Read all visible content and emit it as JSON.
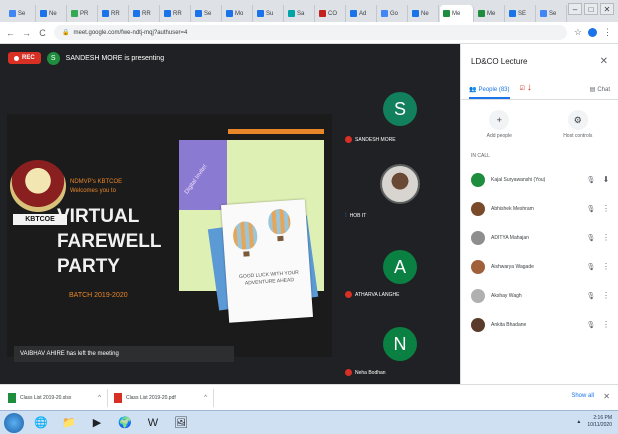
{
  "browser": {
    "tabs": [
      {
        "label": "Se",
        "color": "#4285f4"
      },
      {
        "label": "Ne",
        "color": "#1a73e8"
      },
      {
        "label": "PR",
        "color": "#34a853"
      },
      {
        "label": "RR",
        "color": "#1a73e8"
      },
      {
        "label": "RR",
        "color": "#1a73e8"
      },
      {
        "label": "RR",
        "color": "#1a73e8"
      },
      {
        "label": "Se",
        "color": "#1a73e8"
      },
      {
        "label": "Mo",
        "color": "#1a73e8"
      },
      {
        "label": "Su",
        "color": "#1a73e8"
      },
      {
        "label": "Sa",
        "color": "#00a4a6"
      },
      {
        "label": "CO",
        "color": "#c5221f"
      },
      {
        "label": "Ad",
        "color": "#1a73e8"
      },
      {
        "label": "Go",
        "color": "#4285f4"
      },
      {
        "label": "Ne",
        "color": "#1a73e8"
      },
      {
        "label": "Me",
        "color": "#1e8e3e",
        "active": true
      },
      {
        "label": "Me",
        "color": "#1e8e3e"
      },
      {
        "label": "SE",
        "color": "#1a73e8"
      },
      {
        "label": "Se",
        "color": "#4285f4"
      }
    ],
    "new_tab": "+",
    "window_controls": [
      "–",
      "□",
      "✕"
    ],
    "nav": {
      "back": "←",
      "forward": "→",
      "reload": "C"
    },
    "url": "meet.google.com/fwe-ndtj-mqj?authuser=4",
    "lock": "🔒"
  },
  "meeting": {
    "rec_label": "REC",
    "presenter_initial": "S",
    "presenting_text": "SANDESH MORE is presenting",
    "toast": "VAIBHAV AHIRE has left the meeting"
  },
  "slide": {
    "logo_text": "KBTCOE",
    "welcome_line1": "NDMVP's KBTCOE",
    "welcome_line2": "Welcomes you to",
    "title_line1": "VIRTUAL",
    "title_line2": "FAREWELL",
    "title_line3": "PARTY",
    "batch": "BATCH 2019-2020",
    "ribbon": "Digital Invite!",
    "card_text": "GOOD LUCK WITH YOUR ADVENTURE AHEAD"
  },
  "tiles": [
    {
      "initial": "S",
      "name": "SANDESH MORE",
      "color": "#12805c",
      "type": "avatar"
    },
    {
      "initial": "",
      "name": "HOB IT",
      "color": "",
      "type": "video"
    },
    {
      "initial": "A",
      "name": "ATHARVA LANGHE",
      "color": "#0b8043",
      "type": "avatar"
    },
    {
      "initial": "N",
      "name": "Neha Bodhan",
      "color": "#0b8043",
      "type": "avatar"
    }
  ],
  "panel": {
    "title": "LD&CO Lecture",
    "close": "✕",
    "tab_people": "People (83)",
    "tab_chat": "Chat",
    "add_people": "Add people",
    "host_controls": "Host controls",
    "section": "IN CALL",
    "participants": [
      {
        "name": "Kajal Suryawanshi (You)",
        "color": "#1e8e3e"
      },
      {
        "name": "Abhishek Meshram",
        "color": "#7a4b2a"
      },
      {
        "name": "ADITYA Mahajan",
        "color": "#8e8e8e"
      },
      {
        "name": "Aishwarya Wagade",
        "color": "#a0603a"
      },
      {
        "name": "Akshay Wagh",
        "color": "#b0b0b0"
      },
      {
        "name": "Ankita Bhadane",
        "color": "#5a3a2a"
      }
    ]
  },
  "downloads": [
    {
      "name": "Class List 2019-20.xlsx",
      "kind": "xls"
    },
    {
      "name": "Class List 2019-20.pdf",
      "kind": "pdf"
    }
  ],
  "shelf": {
    "show_all": "Show all",
    "close": "✕"
  },
  "taskbar": {
    "apps": [
      "🌐",
      "📁",
      "▶",
      "🌍",
      "W",
      "🖼"
    ],
    "time": "2:16 PM",
    "date": "10/11/2020"
  }
}
